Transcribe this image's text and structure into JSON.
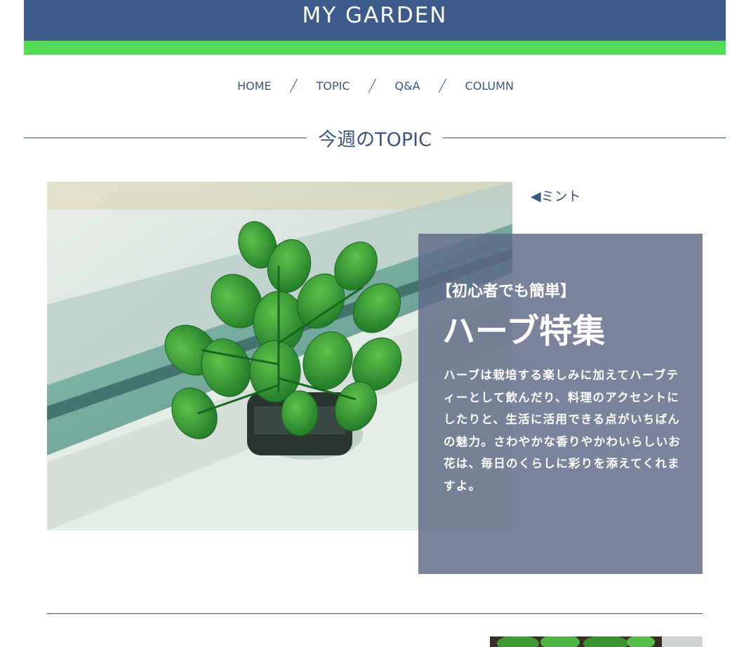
{
  "header": {
    "title": "MY GARDEN",
    "bg_color": "#3c5a8a",
    "accent_color": "#55dc55"
  },
  "nav": {
    "items": [
      "HOME",
      "TOPIC",
      "Q&A",
      "COLUMN"
    ]
  },
  "section": {
    "title": "今週のTOPIC"
  },
  "topic": {
    "photo_alt": "mint-plant-photo",
    "caption": "◀ミント",
    "card": {
      "subtitle": "【初心者でも簡単】",
      "title": "ハーブ特集",
      "body": "ハーブは栽培する楽しみに加えてハーブティーとして飲んだり、料理のアクセントにしたりと、生活に活用できる点がいちばんの魅力。さわやかな香りやかわいらしいお花は、毎日のくらしに彩りを添えてくれますよ。"
    }
  }
}
